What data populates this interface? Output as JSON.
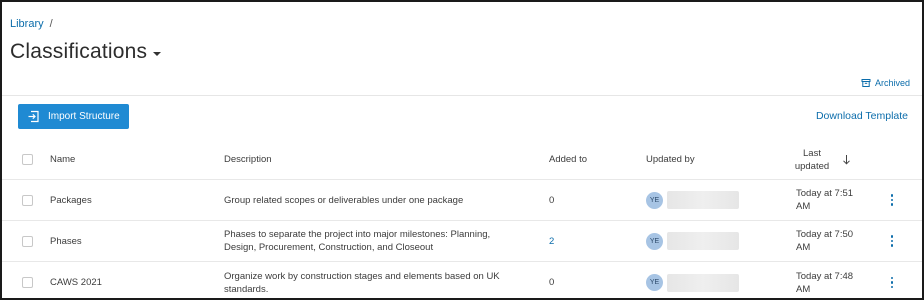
{
  "breadcrumb": {
    "root": "Library",
    "separator": "/"
  },
  "page": {
    "title": "Classifications"
  },
  "toolbar": {
    "archived_label": "Archived",
    "import_label": "Import Structure",
    "download_label": "Download Template"
  },
  "table": {
    "headers": {
      "name": "Name",
      "description": "Description",
      "added_to": "Added to",
      "updated_by": "Updated by",
      "last_updated": "Last updated"
    },
    "sort": {
      "column": "last_updated",
      "direction": "descending"
    },
    "rows": [
      {
        "name": "Packages",
        "description": "Group related scopes or deliverables under one package",
        "added_to": "0",
        "added_to_is_link": false,
        "updated_by_initials": "YE",
        "last_updated": "Today at 7:51 AM"
      },
      {
        "name": "Phases",
        "description": "Phases to separate the project into major milestones: Planning, Design, Procurement, Construction, and Closeout",
        "added_to": "2",
        "added_to_is_link": true,
        "updated_by_initials": "YE",
        "last_updated": "Today at 7:50 AM"
      },
      {
        "name": "CAWS 2021",
        "description": "Organize work by construction stages and elements based on UK standards.",
        "added_to": "0",
        "added_to_is_link": false,
        "updated_by_initials": "YE",
        "last_updated": "Today at 7:48 AM"
      }
    ]
  },
  "icons": {
    "archive": "archive-icon",
    "import": "import-icon",
    "sort": "sort-arrow-down-icon",
    "menu": "more-vertical-icon",
    "dropdown": "caret-down-icon"
  },
  "colors": {
    "accent": "#1f8ad3",
    "link": "#0c6dab",
    "avatar_bg": "#a7c4e4"
  }
}
